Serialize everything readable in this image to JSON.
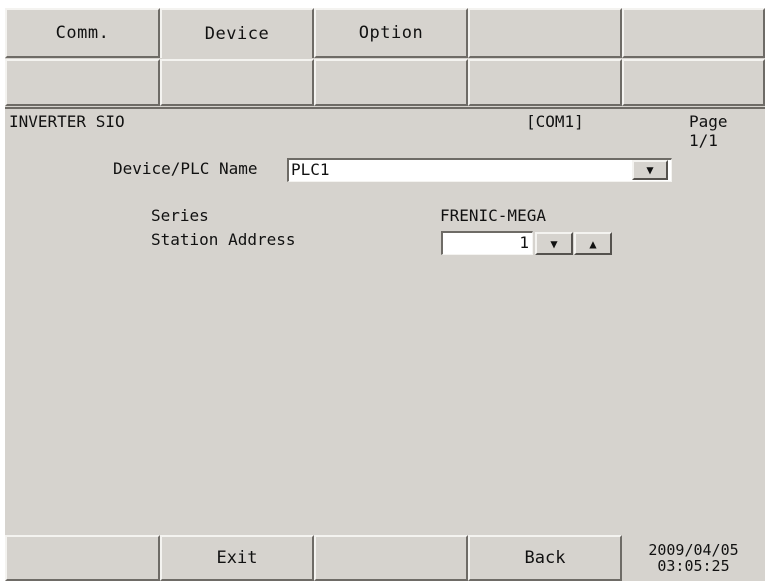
{
  "tabs_row1": [
    "Comm.",
    "Device",
    "Option",
    "",
    ""
  ],
  "active_tab": "Device",
  "tabs_row2": [
    "",
    "",
    "",
    "",
    ""
  ],
  "status": {
    "device_type": "INVERTER SIO",
    "port": "[COM1]",
    "page": "Page 1/1"
  },
  "form": {
    "device_name_label": "Device/PLC Name",
    "device_name_value": "PLC1",
    "series_label": "Series",
    "series_value": "FRENIC-MEGA",
    "station_label": "Station Address",
    "station_value": "1"
  },
  "icons": {
    "dropdown": "triangle-down-icon",
    "decrement": "triangle-down-icon",
    "increment": "triangle-up-icon"
  },
  "bottom": {
    "exit_label": "Exit",
    "back_label": "Back",
    "date": "2009/04/05",
    "time": "03:05:25"
  },
  "colors": {
    "panel": "#d6d3ce",
    "field": "#ffffff",
    "text": "#111111"
  }
}
